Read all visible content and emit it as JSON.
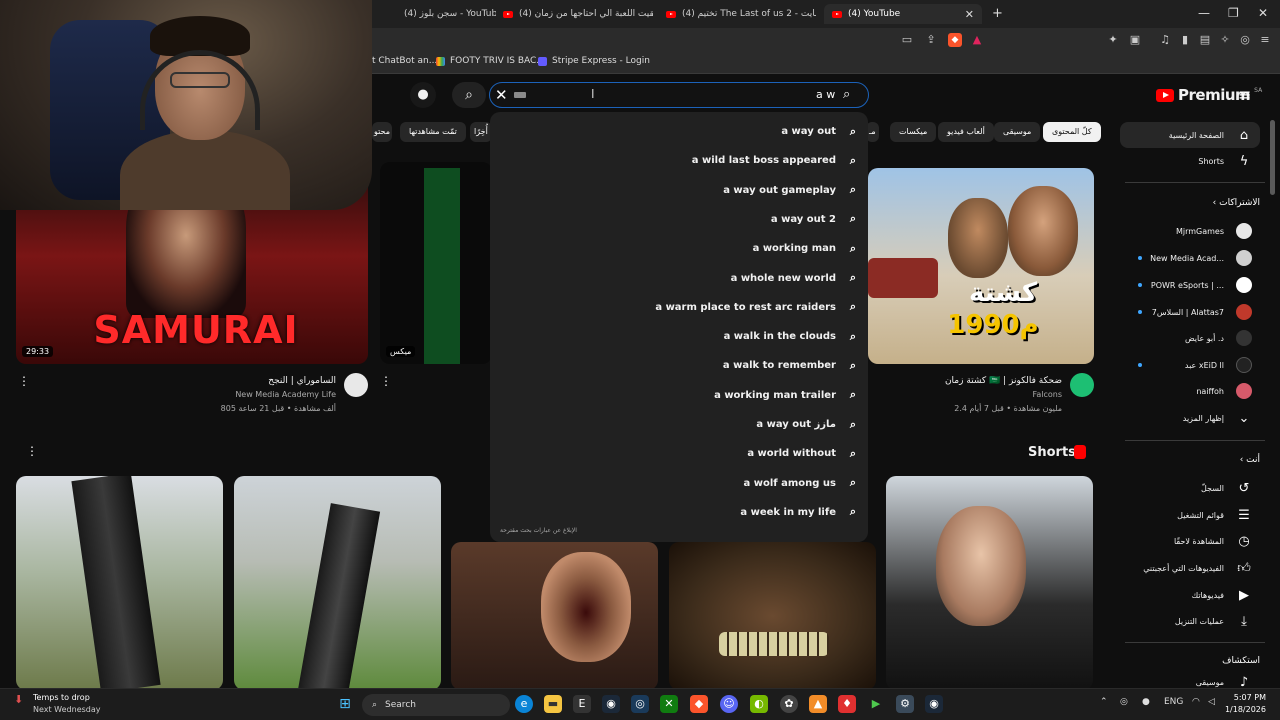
{
  "browser": {
    "tabs": [
      {
        "label": "(4) سجن بلوز - YouTube"
      },
      {
        "label": "(4) لقيت اللعبة الي احتاجها من زمان be..."
      },
      {
        "label": "(4) تختيم The Last of us 2 - قلبي مايت..."
      },
      {
        "label": "(4) YouTube"
      }
    ],
    "bookmarks": [
      {
        "label": "t ChatBot an..."
      },
      {
        "label": "FOOTY TRIV IS BAC..."
      },
      {
        "label": "Stripe Express - Login"
      }
    ],
    "window_controls": {
      "minimize": "—",
      "restore": "❐",
      "close": "✕"
    }
  },
  "youtube": {
    "logo": {
      "word": "Premium",
      "region": "SA"
    },
    "search": {
      "query": "a w",
      "placeholder": ""
    },
    "chips": [
      {
        "label": "كلّ المحتوى",
        "active": true
      },
      {
        "label": "موسيقى"
      },
      {
        "label": "ألعاب فيديو"
      },
      {
        "label": "ميكسات"
      },
      {
        "label": "مـ"
      },
      {
        "label": "أُخِرًا"
      },
      {
        "label": "تمّت مشاهدتها"
      },
      {
        "label": "محتو"
      }
    ],
    "suggestions": [
      "a way out",
      "a wild last boss appeared",
      "a way out gameplay",
      "a way out 2",
      "a working man",
      "a whole new world",
      "a warm place to rest arc raiders",
      "a walk in the clouds",
      "a walk to remember",
      "a working man trailer",
      "a way out مازز",
      "a world without",
      "a wolf among us",
      "a week in my life"
    ],
    "suggest_report": "الإبلاغ عن عبارات بحث مقترحة",
    "sidebar": {
      "home": "الصفحة الرئيسية",
      "shorts": "Shorts",
      "subs_header": "الاشتراكات",
      "channels": [
        {
          "name": "MjrmGames",
          "dot": false,
          "color": "#e8e8e8"
        },
        {
          "name": "New Media Acad...",
          "dot": true,
          "color": "#cfcfcf"
        },
        {
          "name": "POWR eSports | ...",
          "dot": true,
          "color": "#ffffff"
        },
        {
          "name": "السلاس7 | Alattas7",
          "dot": true,
          "color": "#c0392b"
        },
        {
          "name": "د. أبو عايض",
          "dot": false,
          "color": "#333333"
        },
        {
          "name": "عبد xEiD ll",
          "dot": true,
          "color": "#222222"
        },
        {
          "name": "naiffoh",
          "dot": false,
          "color": "#d65a6a"
        }
      ],
      "show_more": "إظهار المزيد",
      "you_header": "أنت",
      "you_items": [
        {
          "label": "السجلّ",
          "icon": "history-icon"
        },
        {
          "label": "قوائم التشغيل",
          "icon": "playlists-icon"
        },
        {
          "label": "المشاهدة لاحقًا",
          "icon": "watch-later-icon"
        },
        {
          "label": "الفيديوهات التي أعجبتني",
          "icon": "like-icon"
        },
        {
          "label": "فيديوهاتك",
          "icon": "your-videos-icon"
        },
        {
          "label": "عمليات التنزيل",
          "icon": "download-icon"
        }
      ],
      "explore_header": "استكشاف",
      "explore_partial": "موسيقى"
    },
    "videos": [
      {
        "title": "الساموراي | النجح",
        "channel": "New Media Academy Life",
        "meta": "805 ألف مشاهدة • قبل 21 ساعة",
        "duration": "29:33",
        "thumb_text": "SAMURAI"
      },
      {
        "title": "",
        "channel": "",
        "meta": "",
        "duration": "ميكس",
        "thumb_text": ""
      },
      {
        "title": "كشتة زمان 🇸🇦 | ضحكة فالكونز",
        "channel": "Falcons",
        "meta": "2.4 مليون مشاهدة • قبل 7 أيام",
        "duration": "",
        "thumb_text": "كشتة",
        "thumb_year": "1990م"
      }
    ],
    "shorts_title": "Shorts"
  },
  "taskbar": {
    "weather": "Temps to drop",
    "weather_sub": "Next Wednesday",
    "search_label": "Search",
    "lang": "ENG",
    "time": "5:07 PM",
    "date": "1/18/2026"
  },
  "colors": {
    "accent_red": "#ff0000",
    "search_border": "#1c62b9",
    "bg": "#0f0f0f"
  }
}
